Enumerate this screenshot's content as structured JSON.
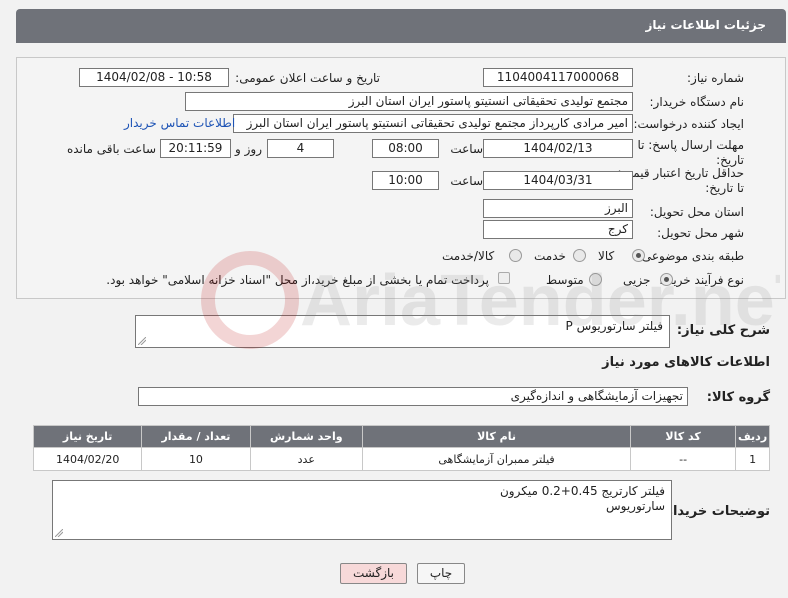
{
  "header": {
    "title": "جزئیات اطلاعات نیاز"
  },
  "form": {
    "need_number_label": "شماره نیاز:",
    "need_number": "1104004117000068",
    "announce_label": "تاریخ و ساعت اعلان عمومی:",
    "announce_value": "1404/02/08 - 10:58",
    "buyer_org_label": "نام دستگاه خریدار:",
    "buyer_org": "مجتمع تولیدی تحقیقاتی انستیتو پاستور ایران استان البرز",
    "creator_label": "ایجاد کننده درخواست:",
    "creator": "امیر مرادی کارپرداز مجتمع تولیدی تحقیقاتی انستیتو پاستور ایران استان البرز",
    "contact_link": "اطلاعات تماس خریدار",
    "deadline_label_1": "مهلت ارسال پاسخ: تا",
    "deadline_label_2": "تاریخ:",
    "deadline_date": "1404/02/13",
    "time_label": "ساعت",
    "deadline_time": "08:00",
    "days_value": "4",
    "days_label": "روز و",
    "remaining_value": "20:11:59",
    "remaining_label": "ساعت باقی مانده",
    "validity_label_1": "حداقل تاریخ اعتبار قیمت:",
    "validity_label_2": "تا تاریخ:",
    "validity_date": "1404/03/31",
    "validity_time": "10:00",
    "province_label": "استان محل تحویل:",
    "province": "البرز",
    "city_label": "شهر محل تحویل:",
    "city": "کرج",
    "category_label": "طبقه بندی موضوعی:",
    "category_options": [
      "کالا",
      "خدمت",
      "کالا/خدمت"
    ],
    "process_label": "نوع فرآیند خرید :",
    "process_options": [
      "جزیی",
      "متوسط"
    ],
    "payment_note": "پرداخت تمام یا بخشی از مبلغ خرید،از محل \"اسناد خزانه اسلامی\" خواهد بود."
  },
  "summary": {
    "label": "شرح کلی نیاز:",
    "value": "فیلتر سارتوریوس P"
  },
  "items_section": {
    "title": "اطلاعات کالاهای مورد نیاز",
    "group_label": "گروه کالا:",
    "group_value": "تجهیزات آزمایشگاهی و اندازه‌گیری",
    "columns": [
      "ردیف",
      "کد کالا",
      "نام کالا",
      "واحد شمارش",
      "تعداد / مقدار",
      "تاریخ نیاز"
    ],
    "rows": [
      {
        "row": "1",
        "code": "--",
        "name": "فیلتر ممبران آزمایشگاهی",
        "unit": "عدد",
        "qty": "10",
        "date": "1404/02/20"
      }
    ]
  },
  "buyer_notes": {
    "label": "توضیحات خریدار:",
    "line1": "فیلتر کارتریج 0.45+0.2 میکرون",
    "line2": "سارتوریوس"
  },
  "buttons": {
    "print": "چاپ",
    "back": "بازگشت"
  },
  "watermark_text": "AriaTender.neT",
  "colors": {
    "header": "#6f7279",
    "link": "#1d53b5",
    "back_button": "#f7d9d9"
  }
}
